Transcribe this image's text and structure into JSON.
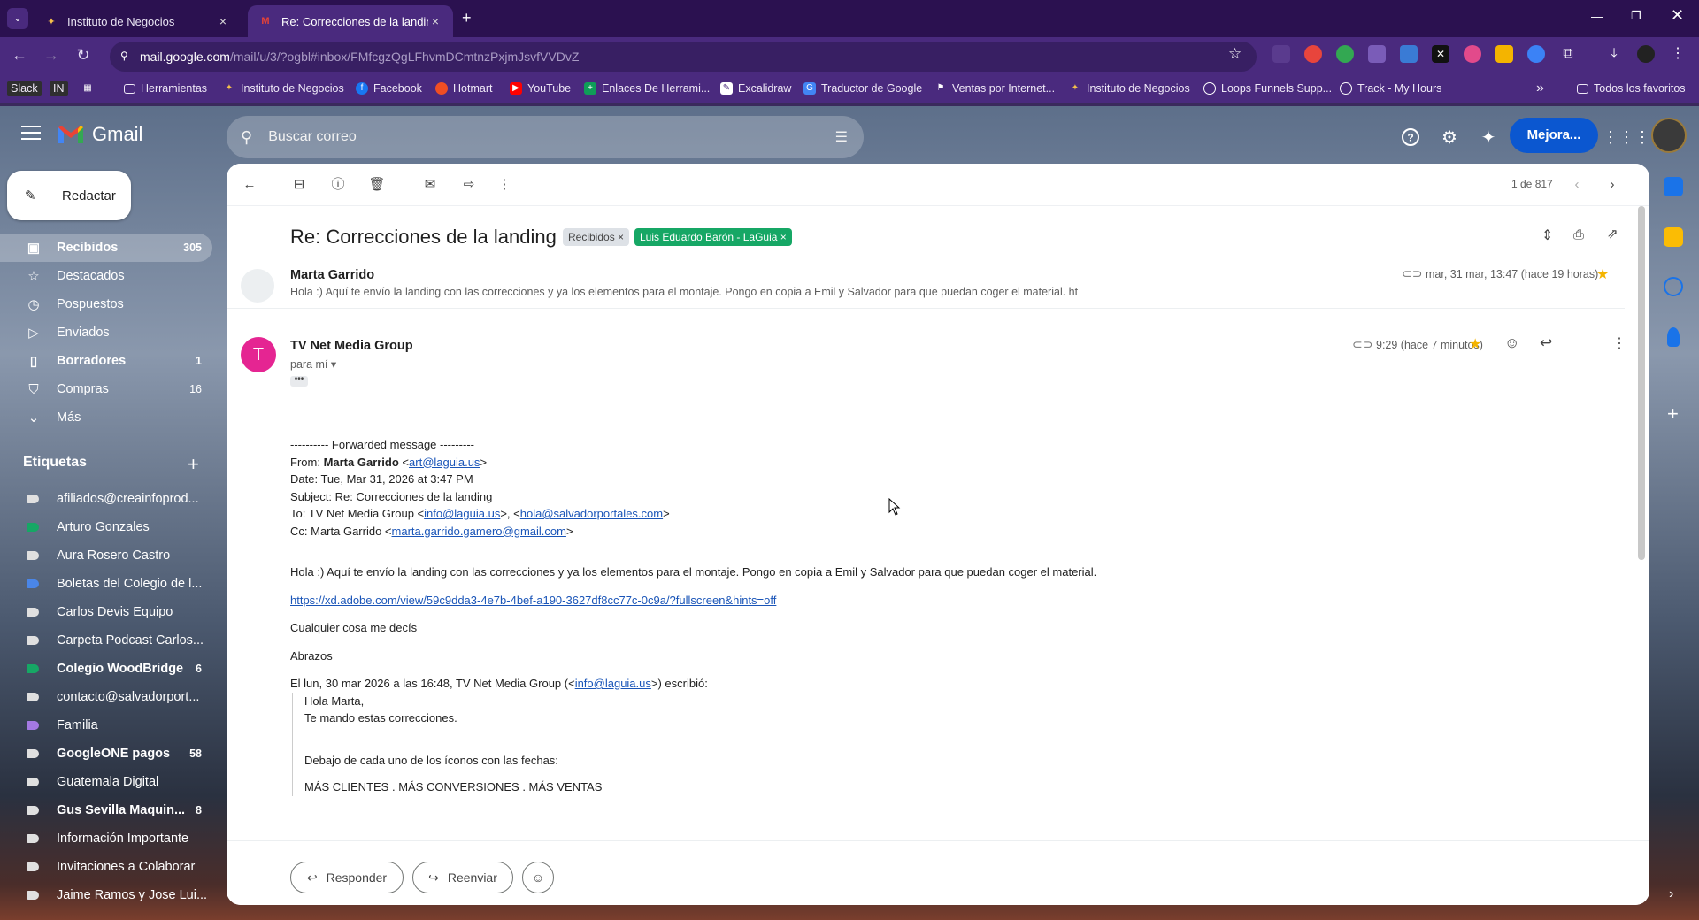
{
  "browser": {
    "tabs": [
      {
        "title": "Instituto de Negocios",
        "active": false
      },
      {
        "title": "Re: Correcciones de la landing",
        "active": true
      }
    ],
    "url_main": "mail.google.com",
    "url_rest": "/mail/u/3/?ogbl#inbox/FMfcgzQgLFhvmDCmtnzPxjmJsvfVVDvZ",
    "bookmarks": [
      "Slack",
      "IN",
      "Herramientas",
      "Instituto de Negocios",
      "Facebook",
      "Hotmart",
      "YouTube",
      "Enlaces De Herrami...",
      "Excalidraw",
      "Traductor de Google",
      "Ventas por Internet...",
      "Instituto de Negocios",
      "Loops Funnels Supp...",
      "Track - My Hours",
      "Todos los favoritos"
    ]
  },
  "gmail": {
    "logo_text": "Gmail",
    "search_placeholder": "Buscar correo",
    "upgrade_label": "Mejora...",
    "compose_label": "Redactar"
  },
  "sidebar": {
    "items": [
      {
        "label": "Recibidos",
        "count": "305",
        "icon": "inbox-icon",
        "selected": true,
        "bold": true
      },
      {
        "label": "Destacados",
        "count": "",
        "icon": "star-icon",
        "selected": false,
        "bold": false
      },
      {
        "label": "Pospuestos",
        "count": "",
        "icon": "clock-icon",
        "selected": false,
        "bold": false
      },
      {
        "label": "Enviados",
        "count": "",
        "icon": "send-icon",
        "selected": false,
        "bold": false
      },
      {
        "label": "Borradores",
        "count": "1",
        "icon": "draft-icon",
        "selected": false,
        "bold": true
      },
      {
        "label": "Compras",
        "count": "16",
        "icon": "shopping-icon",
        "selected": false,
        "bold": false
      },
      {
        "label": "Más",
        "count": "",
        "icon": "chevron-down-icon",
        "selected": false,
        "bold": false
      }
    ],
    "labels_title": "Etiquetas",
    "labels": [
      {
        "label": "afiliados@creainfoprod...",
        "count": "",
        "color": "#e0e0e0",
        "bold": false
      },
      {
        "label": "Arturo Gonzales",
        "count": "",
        "color": "#16a765",
        "bold": false
      },
      {
        "label": "Aura Rosero Castro",
        "count": "",
        "color": "#e0e0e0",
        "bold": false
      },
      {
        "label": "Boletas del Colegio de l...",
        "count": "",
        "color": "#4a86e8",
        "bold": false
      },
      {
        "label": "Carlos Devis Equipo",
        "count": "",
        "color": "#e0e0e0",
        "bold": false
      },
      {
        "label": "Carpeta Podcast Carlos...",
        "count": "",
        "color": "#e0e0e0",
        "bold": false
      },
      {
        "label": "Colegio WoodBridge",
        "count": "6",
        "color": "#16a765",
        "bold": true
      },
      {
        "label": "contacto@salvadorport...",
        "count": "",
        "color": "#e0e0e0",
        "bold": false
      },
      {
        "label": "Familia",
        "count": "",
        "color": "#a479e2",
        "bold": false
      },
      {
        "label": "GoogleONE pagos",
        "count": "58",
        "color": "#e0e0e0",
        "bold": true
      },
      {
        "label": "Guatemala Digital",
        "count": "",
        "color": "#e0e0e0",
        "bold": false
      },
      {
        "label": "Gus Sevilla Maquin...",
        "count": "8",
        "color": "#e0e0e0",
        "bold": true
      },
      {
        "label": "Información Importante",
        "count": "",
        "color": "#e0e0e0",
        "bold": false
      },
      {
        "label": "Invitaciones a Colaborar",
        "count": "",
        "color": "#e0e0e0",
        "bold": false
      },
      {
        "label": "Jaime Ramos y Jose Lui...",
        "count": "",
        "color": "#e0e0e0",
        "bold": false
      }
    ]
  },
  "thread": {
    "pager": "1 de 817",
    "subject": "Re: Correcciones de la landing",
    "chips": [
      "Recibidos",
      "Luis Eduardo Barón - LaGuia"
    ],
    "collapsed": {
      "sender": "Marta Garrido",
      "snippet": "Hola :) Aquí te envío la landing con las correcciones y ya los elementos para el montaje. Pongo en copia a Emil y Salvador para que puedan coger el material. ht",
      "date": "mar, 31 mar, 13:47 (hace 19 horas)"
    },
    "open": {
      "avatar_letter": "T",
      "sender": "TV Net Media Group",
      "to": "para mí",
      "date": "9:29 (hace 7 minutos)",
      "fwd_header": "---------- Forwarded message ---------",
      "from_label": "From: ",
      "from_name": "Marta Garrido",
      "from_email": "art@laguia.us",
      "date_line": "Date: Tue, Mar 31, 2026 at 3:47 PM",
      "subject_line": "Subject: Re: Correcciones de la landing",
      "to_label": "To: TV Net Media Group <",
      "to_email1": "info@laguia.us",
      "to_email2": "hola@salvadorportales.com",
      "cc_label": "Cc: Marta Garrido <",
      "cc_email": "marta.garrido.gamero@gmail.com",
      "para1": "Hola :) Aquí te envío la landing con las correcciones y ya los elementos para el montaje. Pongo en copia a Emil y Salvador para que puedan coger el material.",
      "link": "https://xd.adobe.com/view/59c9dda3-4e7b-4bef-a190-3627df8cc77c-0c9a/?fullscreen&hints=off",
      "para2": "Cualquier cosa me decís",
      "para3": "Abrazos",
      "quote_intro_a": "El lun, 30 mar 2026 a las 16:48, TV Net Media Group (<",
      "quote_intro_email": "info@laguia.us",
      "quote_intro_b": ">) escribió:",
      "quote_l1": "Hola Marta,",
      "quote_l2": "Te mando estas correcciones.",
      "quote_l3": "Debajo de cada uno de los íconos con las fechas:",
      "quote_l4": "MÁS CLIENTES . MÁS CONVERSIONES . MÁS VENTAS"
    },
    "reply_label": "Responder",
    "forward_label": "Reenviar"
  }
}
